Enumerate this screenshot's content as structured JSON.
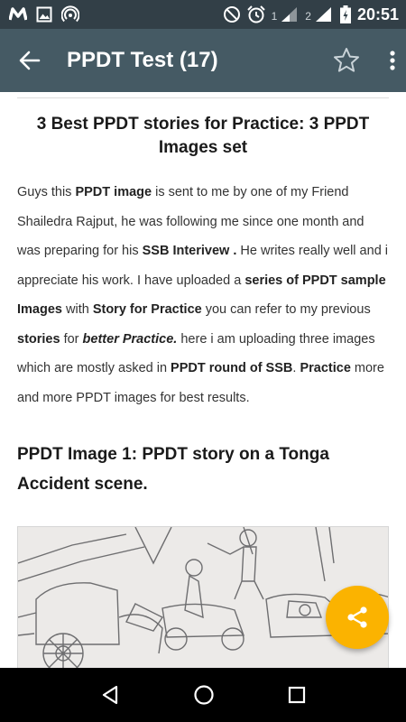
{
  "status_bar": {
    "time": "20:51",
    "sim1": "1",
    "sim2": "2",
    "icons": [
      "m-notification-icon",
      "image-notification-icon",
      "hotspot-icon",
      "do-not-disturb-icon",
      "alarm-icon",
      "signal-icon",
      "battery-icon"
    ]
  },
  "app_bar": {
    "title": "PPDT Test (17)",
    "icons": [
      "back-arrow-icon",
      "star-icon",
      "more-vert-icon"
    ]
  },
  "article": {
    "title": "3 Best PPDT stories for Practice: 3 PPDT Images set",
    "p": {
      "t1": "Guys this ",
      "b1": "PPDT image",
      "t2": " is sent to me by one of my Friend Shailedra Rajput, he was following me since one month and was preparing for his ",
      "b2": "SSB Interivew .",
      "t3": " He writes really well and i appreciate his work. I have uploaded a ",
      "b3": "series of PPDT sample Images",
      "t4": " with ",
      "b4": "Story for Practice",
      "t5": " you can refer to my previous ",
      "b5": "stories",
      "t6": " for ",
      "bi1": "better Practice.",
      "t7": " here i am uploading three images which are mostly asked in ",
      "b6": "PPDT round of SSB",
      "t8": ". ",
      "b7": "Practice",
      "t9": " more and more PPDT images for best results."
    },
    "section_heading": "PPDT Image 1: PPDT story on a Tonga Accident scene."
  },
  "fab": {
    "icon": "share-icon"
  },
  "nav_bar": {
    "icons": [
      "back-triangle-icon",
      "home-circle-icon",
      "recents-square-icon"
    ]
  },
  "colors": {
    "status_bar": "#323f47",
    "app_bar": "#455a64",
    "fab": "#fbb300",
    "nav_bar": "#000000"
  }
}
